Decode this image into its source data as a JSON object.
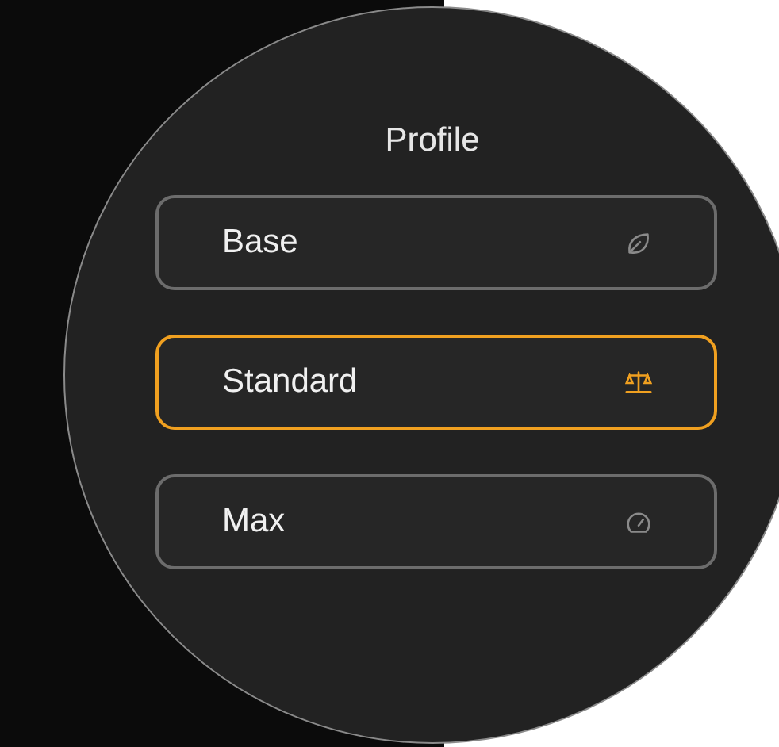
{
  "title": "Profile",
  "profiles": [
    {
      "label": "Base",
      "kind": "leaf",
      "selected": false
    },
    {
      "label": "Standard",
      "kind": "scales",
      "selected": true
    },
    {
      "label": "Max",
      "kind": "gauge",
      "selected": false
    }
  ]
}
